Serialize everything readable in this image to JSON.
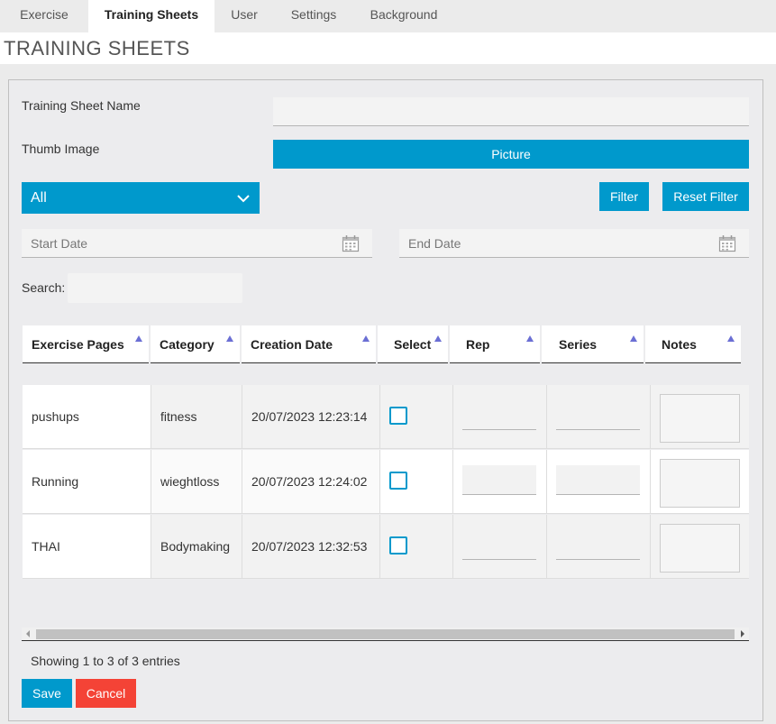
{
  "tabs": [
    {
      "label": "Exercise",
      "active": false
    },
    {
      "label": "Training Sheets",
      "active": true
    },
    {
      "label": "User",
      "active": false
    },
    {
      "label": "Settings",
      "active": false
    },
    {
      "label": "Background",
      "active": false
    }
  ],
  "page_title": "TRAINING SHEETS",
  "form": {
    "name_label": "Training Sheet Name",
    "name_value": "",
    "thumb_label": "Thumb Image",
    "picture_button": "Picture",
    "category_select": "All",
    "filter_button": "Filter",
    "reset_filter_button": "Reset Filter",
    "start_date_placeholder": "Start Date",
    "end_date_placeholder": "End Date",
    "search_label": "Search:",
    "search_value": ""
  },
  "table": {
    "columns": [
      "Exercise Pages",
      "Category",
      "Creation Date",
      "Select",
      "Rep",
      "Series",
      "Notes"
    ],
    "rows": [
      {
        "page": "pushups",
        "category": "fitness",
        "date": "20/07/2023 12:23:14"
      },
      {
        "page": "Running",
        "category": "wieghtloss",
        "date": "20/07/2023 12:24:02"
      },
      {
        "page": "THAI",
        "category": "Bodymaking",
        "date": "20/07/2023 12:32:53"
      }
    ],
    "info": "Showing 1 to 3 of 3 entries"
  },
  "actions": {
    "save_label": "Save",
    "cancel_label": "Cancel"
  },
  "colors": {
    "accent": "#0099cc",
    "danger": "#f44336",
    "sort_arrow": "#6b6fd4"
  },
  "icons": {
    "calendar": "calendar-icon",
    "chevron": "chevron-down-icon",
    "sort": "sort-asc-icon"
  }
}
